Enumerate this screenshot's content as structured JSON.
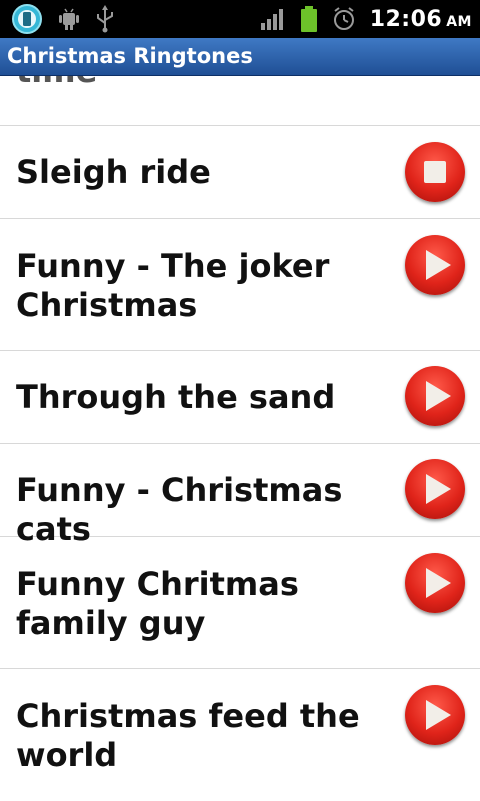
{
  "status_bar": {
    "time": "12:06",
    "ampm": "AM",
    "icons": [
      "app-icon",
      "android-debug-icon",
      "usb-icon",
      "signal-icon",
      "battery-icon",
      "alarm-icon"
    ]
  },
  "app": {
    "title": "Christmas Ringtones"
  },
  "colors": {
    "titlebar": "#2a60ab",
    "button_red": "#e0241a"
  },
  "list": {
    "partial_item": "time",
    "items": [
      {
        "label": "Sleigh ride",
        "state": "stop-icon"
      },
      {
        "label": "Funny - The joker Christmas",
        "state": "play-icon"
      },
      {
        "label": "Through the sand",
        "state": "play-icon"
      },
      {
        "label": "Funny - Christmas cats",
        "state": "play-icon"
      },
      {
        "label": "Funny Chritmas family guy",
        "state": "play-icon"
      },
      {
        "label": "Christmas feed the world",
        "state": "play-icon"
      }
    ]
  }
}
